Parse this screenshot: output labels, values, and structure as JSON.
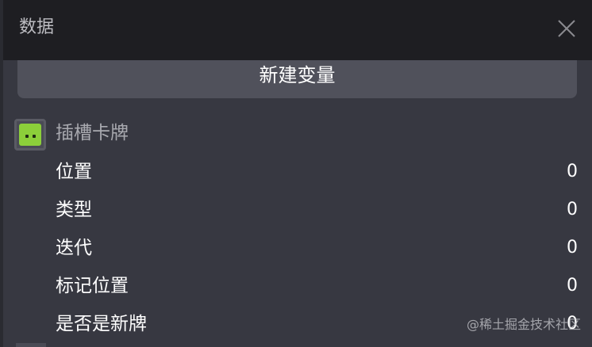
{
  "header": {
    "title": "数据",
    "close_icon": "close-icon"
  },
  "new_variable_button": "新建变量",
  "group": {
    "icon": "slot-card-icon",
    "label": "插槽卡牌",
    "variables": [
      {
        "name": "位置",
        "value": "0"
      },
      {
        "name": "类型",
        "value": "0"
      },
      {
        "name": "迭代",
        "value": "0"
      },
      {
        "name": "标记位置",
        "value": "0"
      },
      {
        "name": "是否是新牌",
        "value": "0"
      }
    ]
  },
  "watermark": "@稀土掘金技术社区",
  "colors": {
    "header_bg": "#1e1e22",
    "panel_bg": "#373841",
    "button_bg": "#50515b",
    "icon_green": "#8ccf3a"
  }
}
